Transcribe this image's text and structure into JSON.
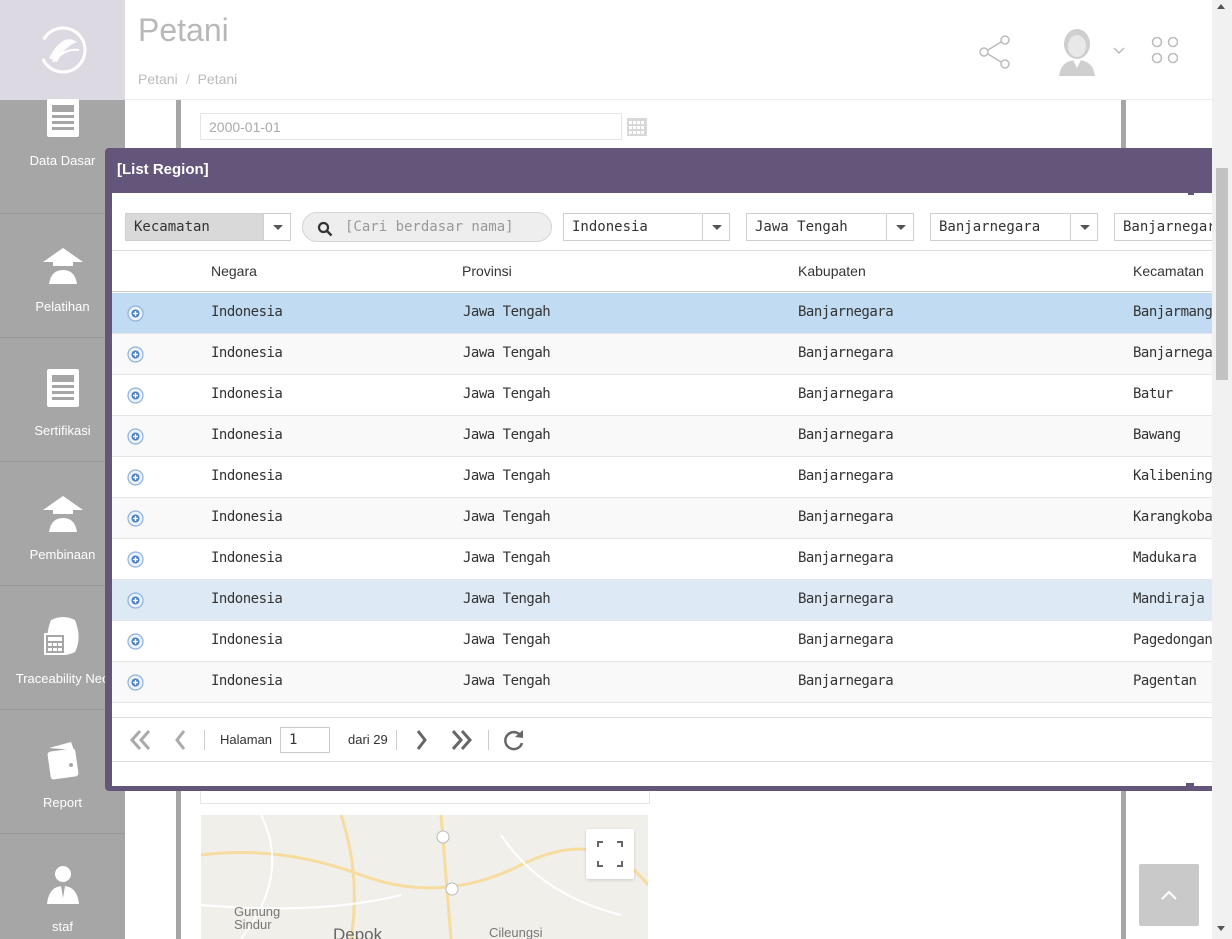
{
  "header": {
    "title": "Petani",
    "breadcrumb": [
      "Petani",
      "Petani"
    ]
  },
  "sidebar": {
    "items": [
      {
        "label": "Data Dasar",
        "icon": "document-icon"
      },
      {
        "label": "Pelatihan",
        "icon": "farmer-hat-icon"
      },
      {
        "label": "Sertifikasi",
        "icon": "document-icon"
      },
      {
        "label": "Pembinaan",
        "icon": "farmer-hat-icon"
      },
      {
        "label": "Traceability Neo",
        "icon": "calculator-sack-icon"
      },
      {
        "label": "Report",
        "icon": "wallet-icon"
      },
      {
        "label": "staf",
        "icon": "person-icon"
      }
    ]
  },
  "background": {
    "date_value": "2000-01-01",
    "map_labels": [
      "Gunung Sindur",
      "Depok",
      "Cileungsi"
    ]
  },
  "modal": {
    "title": "[List Region]",
    "filters": {
      "level": "Kecamatan",
      "search_placeholder": "[Cari berdasar nama]",
      "negara": "Indonesia",
      "provinsi": "Jawa Tengah",
      "kabupaten": "Banjarnegara",
      "kecamatan": "Banjarnegara"
    },
    "columns": [
      "Negara",
      "Provinsi",
      "Kabupaten",
      "Kecamatan"
    ],
    "rows": [
      {
        "negara": "Indonesia",
        "provinsi": "Jawa Tengah",
        "kabupaten": "Banjarnegara",
        "kecamatan": "Banjarmangu"
      },
      {
        "negara": "Indonesia",
        "provinsi": "Jawa Tengah",
        "kabupaten": "Banjarnegara",
        "kecamatan": "Banjarnegara"
      },
      {
        "negara": "Indonesia",
        "provinsi": "Jawa Tengah",
        "kabupaten": "Banjarnegara",
        "kecamatan": "Batur"
      },
      {
        "negara": "Indonesia",
        "provinsi": "Jawa Tengah",
        "kabupaten": "Banjarnegara",
        "kecamatan": "Bawang"
      },
      {
        "negara": "Indonesia",
        "provinsi": "Jawa Tengah",
        "kabupaten": "Banjarnegara",
        "kecamatan": "Kalibening"
      },
      {
        "negara": "Indonesia",
        "provinsi": "Jawa Tengah",
        "kabupaten": "Banjarnegara",
        "kecamatan": "Karangkobar"
      },
      {
        "negara": "Indonesia",
        "provinsi": "Jawa Tengah",
        "kabupaten": "Banjarnegara",
        "kecamatan": "Madukara"
      },
      {
        "negara": "Indonesia",
        "provinsi": "Jawa Tengah",
        "kabupaten": "Banjarnegara",
        "kecamatan": "Mandiraja"
      },
      {
        "negara": "Indonesia",
        "provinsi": "Jawa Tengah",
        "kabupaten": "Banjarnegara",
        "kecamatan": "Pagedongan"
      },
      {
        "negara": "Indonesia",
        "provinsi": "Jawa Tengah",
        "kabupaten": "Banjarnegara",
        "kecamatan": "Pagentan"
      }
    ],
    "selected_row": 0,
    "hover_row": 7,
    "pager": {
      "page_label": "Halaman",
      "page_value": "1",
      "total_label": "dari 29"
    }
  },
  "colors": {
    "modal_header": "#64567a",
    "sidebar": "#a6a6a6",
    "selected_row": "#c0dbf2"
  }
}
